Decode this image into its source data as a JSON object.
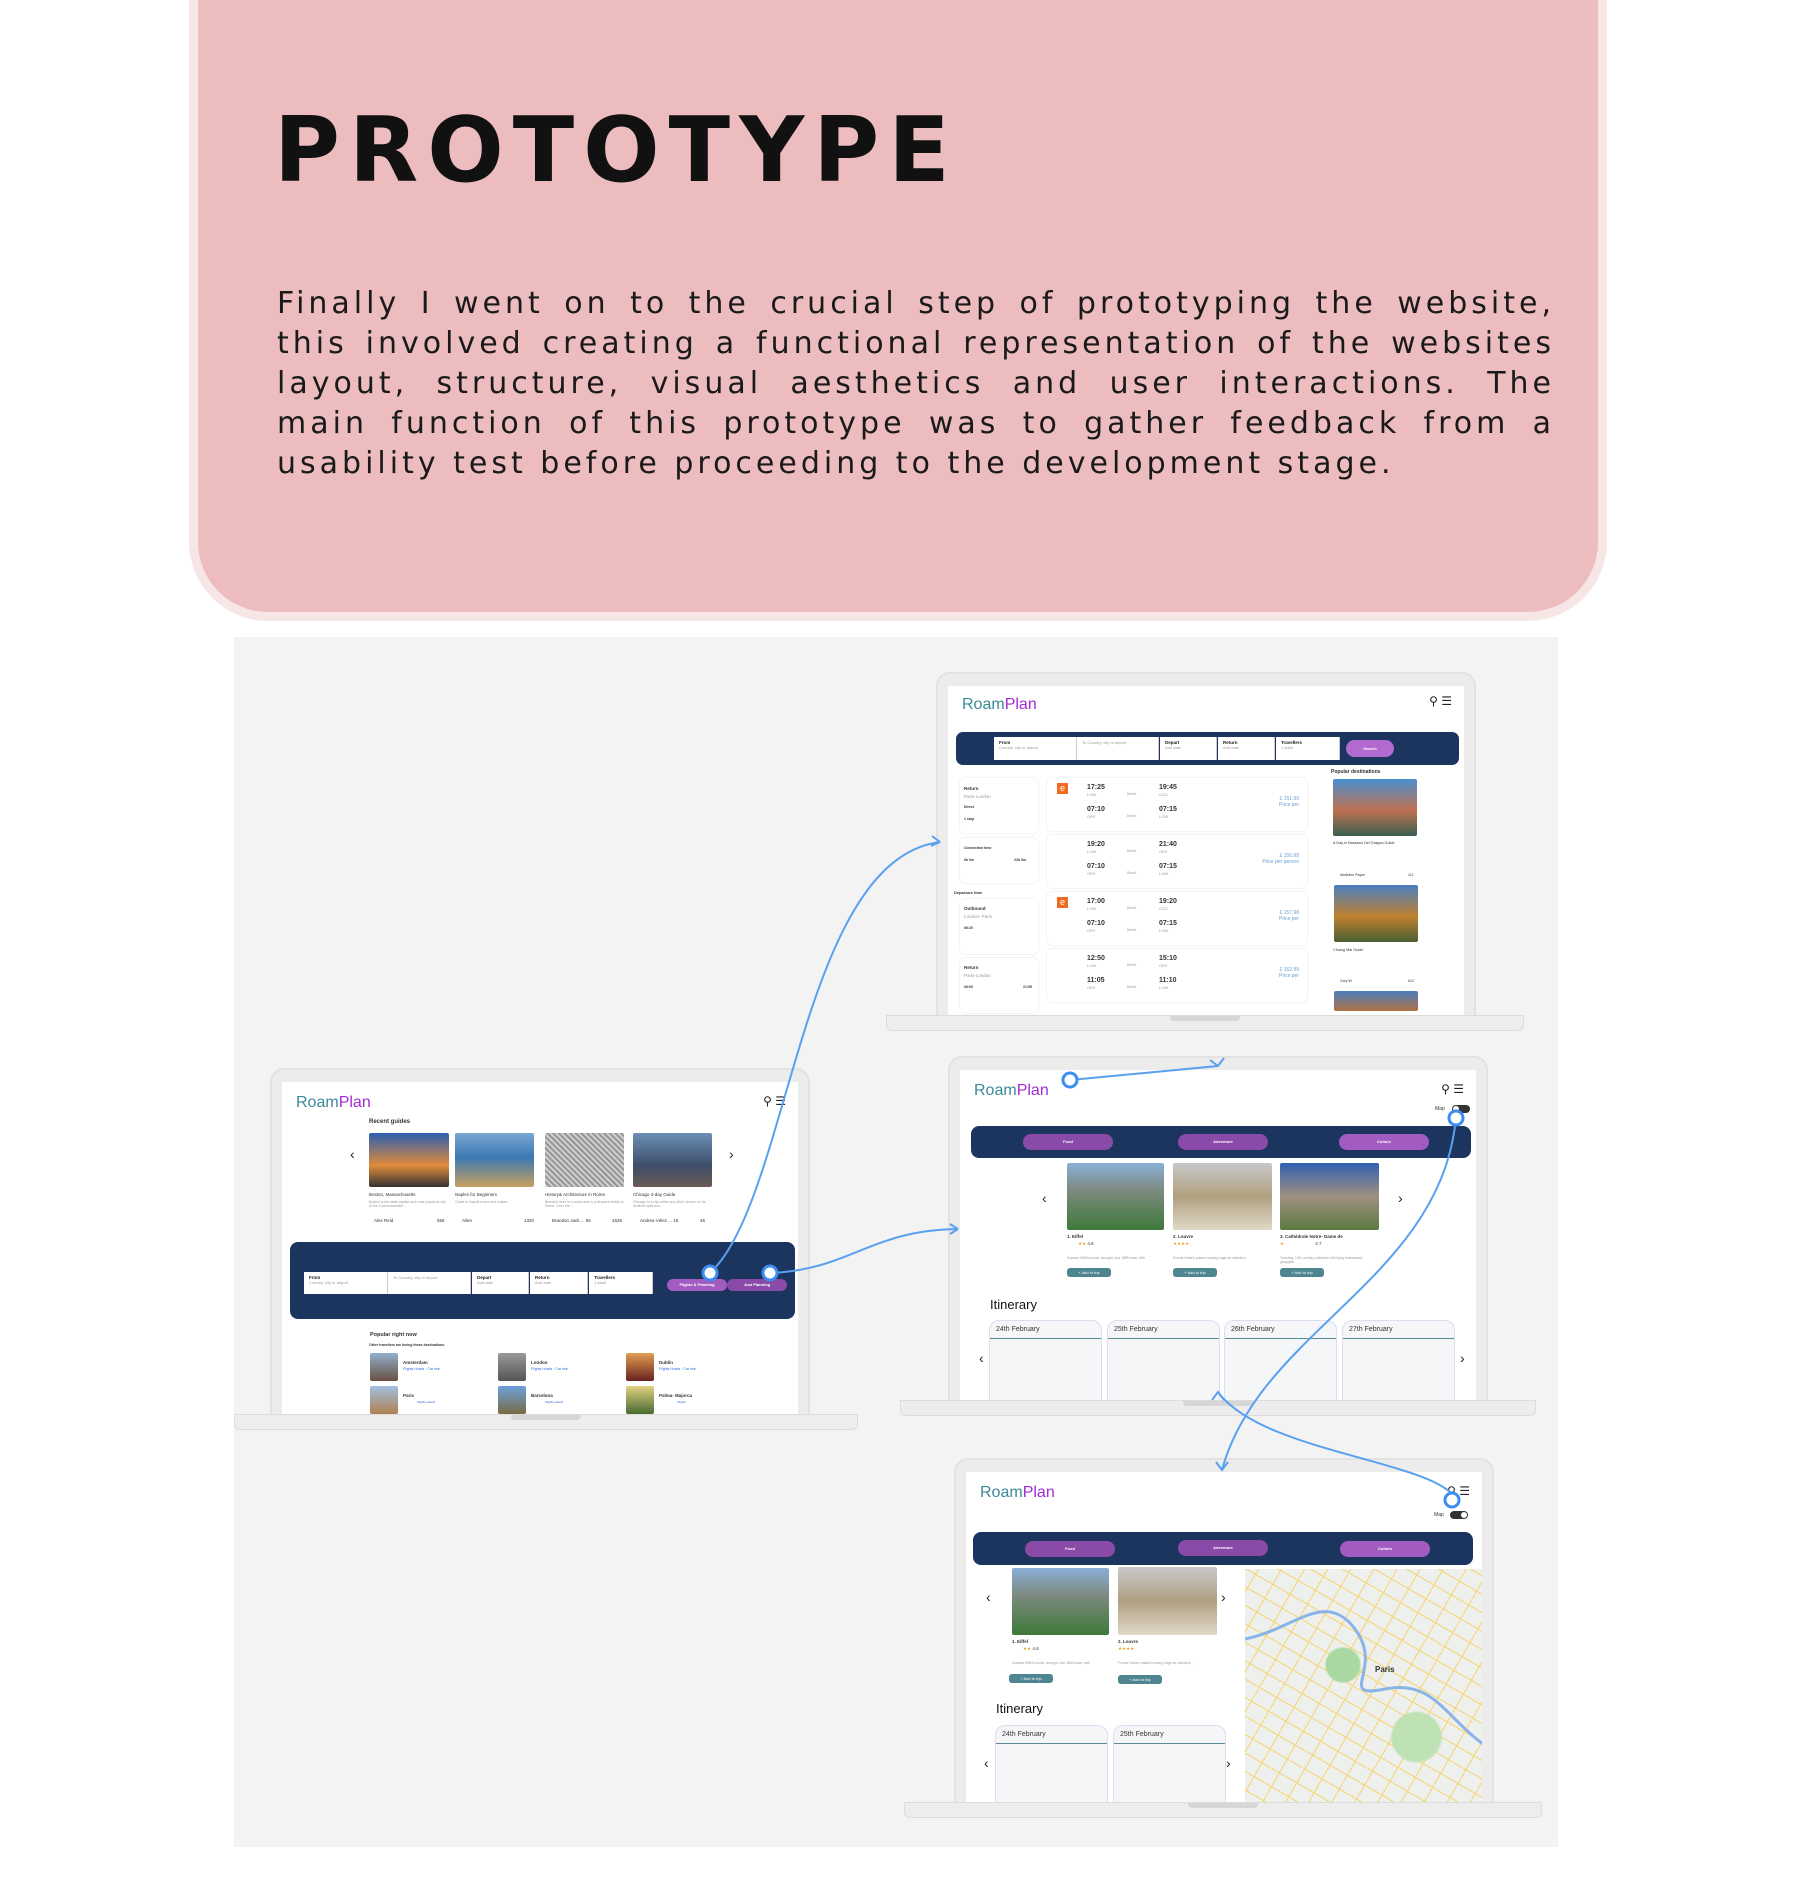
{
  "heading": {
    "title": "PROTOTYPE",
    "body": "Finally I went on to the crucial step of prototyping the website, this involved creating a functional representation of the websites layout, structure, visual aesthetics and user interactions. The main function of this prototype was to gather feedback from a usability test before proceeding to the development stage."
  },
  "brand": {
    "roam": "Roam",
    "plan": "Plan",
    "accent_teal": "#3b8a99",
    "accent_purple": "#a12bd6",
    "band_navy": "#1c355e",
    "pink": "#ecbcbf",
    "wire_blue": "#5aa0f0"
  },
  "icons": {
    "search": "search-icon",
    "menu": "hamburger-menu-icon",
    "prev": "chevron-left-icon",
    "next": "chevron-right-icon"
  },
  "home": {
    "recent_guides": "Recent guides",
    "guides": [
      {
        "title": "Boston, Massachusetts",
        "desc": "Boston is the state capital and most populous city of the Commonwealth ...",
        "author": "Alex Reid",
        "views": "556"
      },
      {
        "title": "Naples for Beginners",
        "desc": "Guide to Napoli's food and culture",
        "author": "Allen",
        "views": "1320"
      },
      {
        "title": "History& Architecture in Rome",
        "desc": "Brandon lives in London and is a frequent visitor to Rome. Over the ...",
        "author": "Brandon Jack ... 56",
        "views": "1625"
      },
      {
        "title": "Chicago 4-day Guide",
        "desc": "Chicago is a city unlike any other, known for its resilient spirit and ...",
        "author": "Andrea Vélez ... 18",
        "views": "46"
      }
    ],
    "search": {
      "from_label": "From",
      "from_ph": "Country, city or airport",
      "to_ph": "To Country, city or airport",
      "depart_label": "Depart",
      "depart_val": "Add date",
      "return_label": "Return",
      "return_val": "Add date",
      "travellers_label": "Travellers",
      "travellers_val": "1 Adult",
      "btn_flights": "Flights & Planning",
      "btn_just": "Just Planning"
    },
    "popular": "Popular right now",
    "popular_sub": "Other travellers are loving these destinations.",
    "destinations": [
      {
        "name": "Amsterdam",
        "links": "Flights Hotels · Car hire"
      },
      {
        "name": "London",
        "links": "Flights Hotels · Car hire"
      },
      {
        "name": "Dublin",
        "links": "Flights Hotels · Car hire"
      },
      {
        "name": "Paris",
        "links": "Flights Hotels"
      },
      {
        "name": "Barcelona",
        "links": "Flights Hotels"
      },
      {
        "name": "Palma- Majorca",
        "links": "Flights"
      }
    ]
  },
  "flights": {
    "search_btn": "Search",
    "filters": {
      "return": "Return",
      "return_route": "Paris-London",
      "direct": "Direct",
      "one_stop": "1 stop",
      "connection": "Connection time",
      "conn_min": "0h 0m",
      "conn_max": "22h 0m",
      "departure": "Departure time",
      "outbound": "Outbound",
      "out_route": "London- Paris",
      "out_time": "06:20",
      "ret_time_a": "06:00",
      "ret_time_b": "21:55"
    },
    "results": [
      {
        "t1": "17:25",
        "a1": "LGW",
        "t2": "19:45",
        "b1": "CDG",
        "t3": "07:10",
        "a3": "ORY",
        "t4": "07:15",
        "b4": "LGW",
        "price": "£ 151.99",
        "pl": "Price per"
      },
      {
        "t1": "19:20",
        "a1": "LGW",
        "t2": "21:40",
        "b1": "ORY",
        "t3": "07:10",
        "a3": "ORY",
        "t4": "07:15",
        "b4": "LGW",
        "price": "£ 156.98",
        "pl": "Price per person"
      },
      {
        "t1": "17:00",
        "a1": "LGW",
        "t2": "19:20",
        "b1": "CDG",
        "t3": "07:10",
        "a3": "ORY",
        "t4": "07:15",
        "b4": "LGW",
        "price": "£ 157.98",
        "pl": "Price per"
      },
      {
        "t1": "12:50",
        "a1": "LGW",
        "t2": "15:10",
        "b1": "ORY",
        "t3": "11:05",
        "a3": "ORY",
        "t4": "11:10",
        "b4": "LGW",
        "price": "£ 162.99",
        "pl": "Price per"
      }
    ],
    "direct": "Direct",
    "popular_dest": "Popular destinations",
    "dest_cards": [
      {
        "title": "A Day in Bassano Del Grappa Guide",
        "author": "Madeline Payne",
        "views": "112"
      },
      {
        "title": "Chiang Mai Guide",
        "author": "Gary W",
        "views": "612"
      }
    ]
  },
  "planner": {
    "map_label": "Map",
    "categories": [
      "Food",
      "Adventure",
      "Culture"
    ],
    "places": [
      {
        "name": "1. Eiffel",
        "rating": "4.6",
        "desc": "Gustave Eiffel's iconic, wrought- iron 1889 tower, with"
      },
      {
        "name": "2. Louvre",
        "rating": "",
        "desc": "Former historic palace housing huge art collection ,"
      },
      {
        "name": "3. Cathédrale Notre- Dame de",
        "rating": "4.7",
        "desc": "Towering, 12th- century cathedral with flying buttresses& gargoyles"
      }
    ],
    "add_btn": "+ Add to trip",
    "itinerary": "Itinerary",
    "days": [
      "24th February",
      "25th February",
      "26th February",
      "27th February"
    ],
    "map_city": "Paris"
  }
}
